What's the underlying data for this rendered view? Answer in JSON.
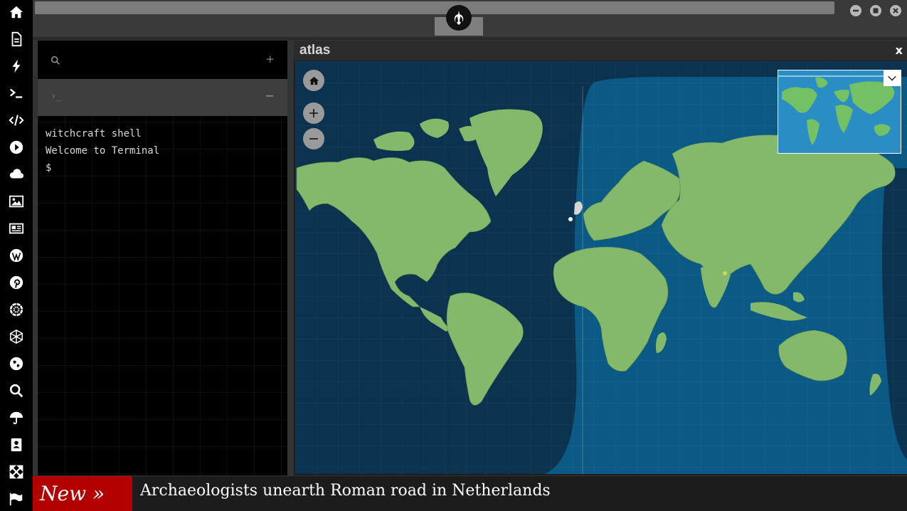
{
  "sidebar": {
    "icons": [
      "home-icon",
      "document-icon",
      "bolt-icon",
      "terminal-icon",
      "code-icon",
      "play-icon",
      "cloud-icon",
      "image-icon",
      "newspaper-icon",
      "wordpress-icon",
      "pinterest-icon",
      "galactic-empire-icon",
      "network-icon",
      "globe-icon",
      "search-icon",
      "umbrella-icon",
      "contacts-icon",
      "expand-icon",
      "flag-icon"
    ]
  },
  "topbar": {
    "logo": "rebel-alliance-icon",
    "window_buttons": [
      "minimize",
      "maximize",
      "close"
    ]
  },
  "terminal": {
    "add_label": "+",
    "collapse_label": "−",
    "lines": [
      "witchcraft shell",
      "Welcome to Terminal",
      "$"
    ]
  },
  "atlas": {
    "title": "atlas",
    "close_label": "x",
    "colors": {
      "ocean_day": "#0b5a86",
      "ocean_night": "#0b3350",
      "land": "#84b86a"
    }
  },
  "ticker": {
    "badge": "New »",
    "headline": "Archaeologists unearth Roman road in Netherlands"
  }
}
